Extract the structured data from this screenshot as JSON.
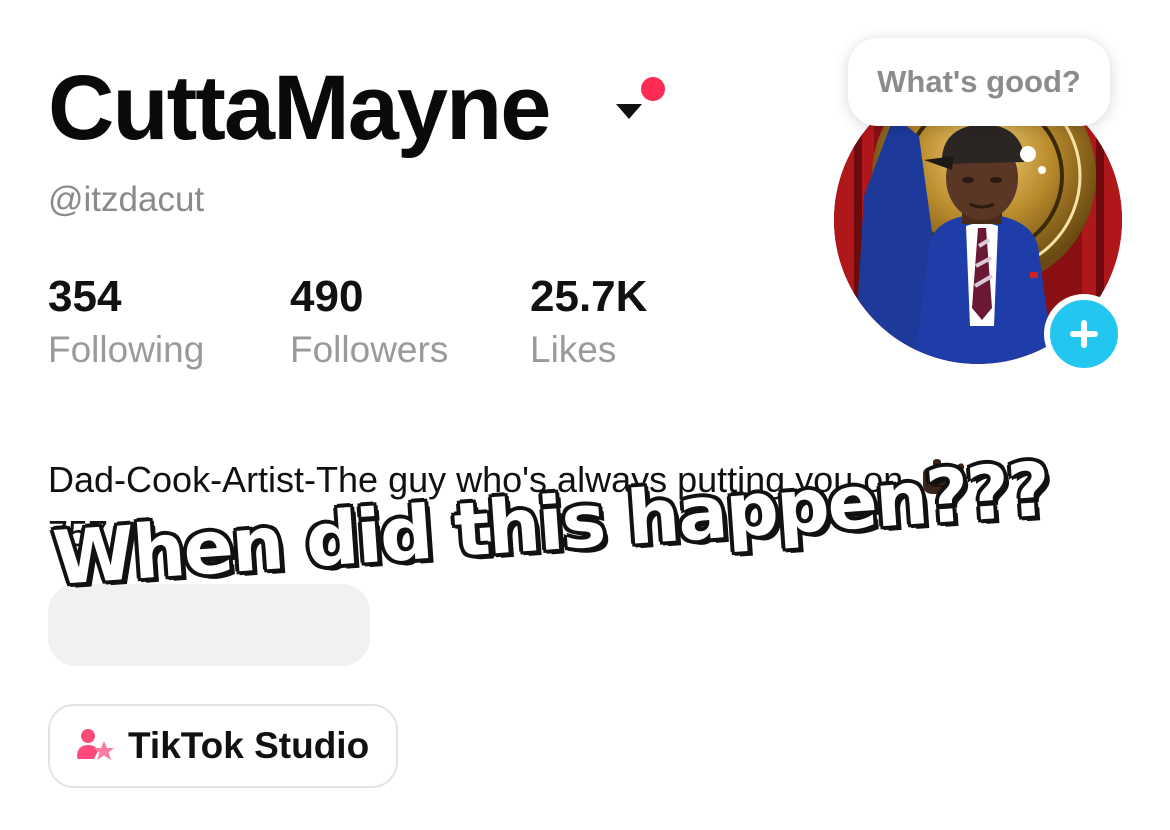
{
  "profile": {
    "display_name": "CuttaMayne",
    "handle": "@itzdacut",
    "bio_line1": "Dad-Cook-Artist-The guy who's always putting you on",
    "bio_line2": "757",
    "bio_emoji_icon": "call-me-hand-icon"
  },
  "stats": [
    {
      "value": "354",
      "label": "Following"
    },
    {
      "value": "490",
      "label": "Followers"
    },
    {
      "value": "25.7K",
      "label": "Likes"
    }
  ],
  "status_bubble": {
    "placeholder": "What's good?"
  },
  "studio_button": {
    "label": "TikTok Studio",
    "icon": "creator-studio-icon"
  },
  "overlay_caption": "When did this happen???",
  "colors": {
    "notification_dot": "#fe2c55",
    "add_badge": "#23c6ee",
    "studio_icon_pink": "#fe4a7a"
  }
}
